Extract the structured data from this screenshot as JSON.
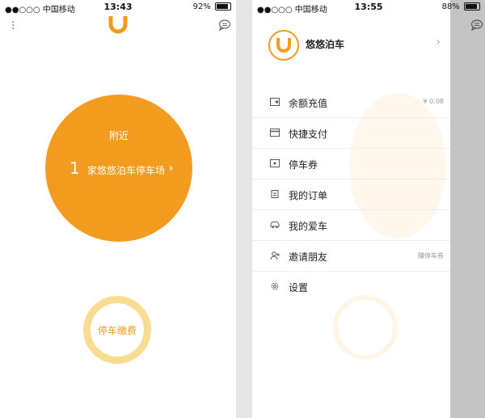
{
  "colors": {
    "brand": "#f29b1e",
    "ring": "#f8dc92",
    "overlay": "#c4c4c4"
  },
  "left": {
    "status": {
      "carrier": "●●○○○ 中国移动",
      "time": "13:43",
      "battery": "92%"
    },
    "logo": "U",
    "nearby_label": "附近",
    "nearby_count": "1",
    "nearby_text": "家悠悠泊车停车场",
    "arrow": "›",
    "pay_button": "停车缴费"
  },
  "right": {
    "status": {
      "carrier": "●●○○○ 中国移动",
      "time": "13:55",
      "battery": "88%"
    },
    "profile": {
      "name": "悠悠泊车",
      "chevron": "›"
    },
    "menu": [
      {
        "icon": "wallet-icon",
        "label": "余额充值",
        "value": "¥ 0.08"
      },
      {
        "icon": "card-icon",
        "label": "快捷支付",
        "value": ""
      },
      {
        "icon": "coupon-icon",
        "label": "停车券",
        "value": ""
      },
      {
        "icon": "order-icon",
        "label": "我的订单",
        "value": ""
      },
      {
        "icon": "car-icon",
        "label": "我的爱车",
        "value": ""
      },
      {
        "icon": "invite-icon",
        "label": "邀请朋友",
        "value": "赚停车券"
      },
      {
        "icon": "settings-icon",
        "label": "设置",
        "value": ""
      }
    ]
  }
}
